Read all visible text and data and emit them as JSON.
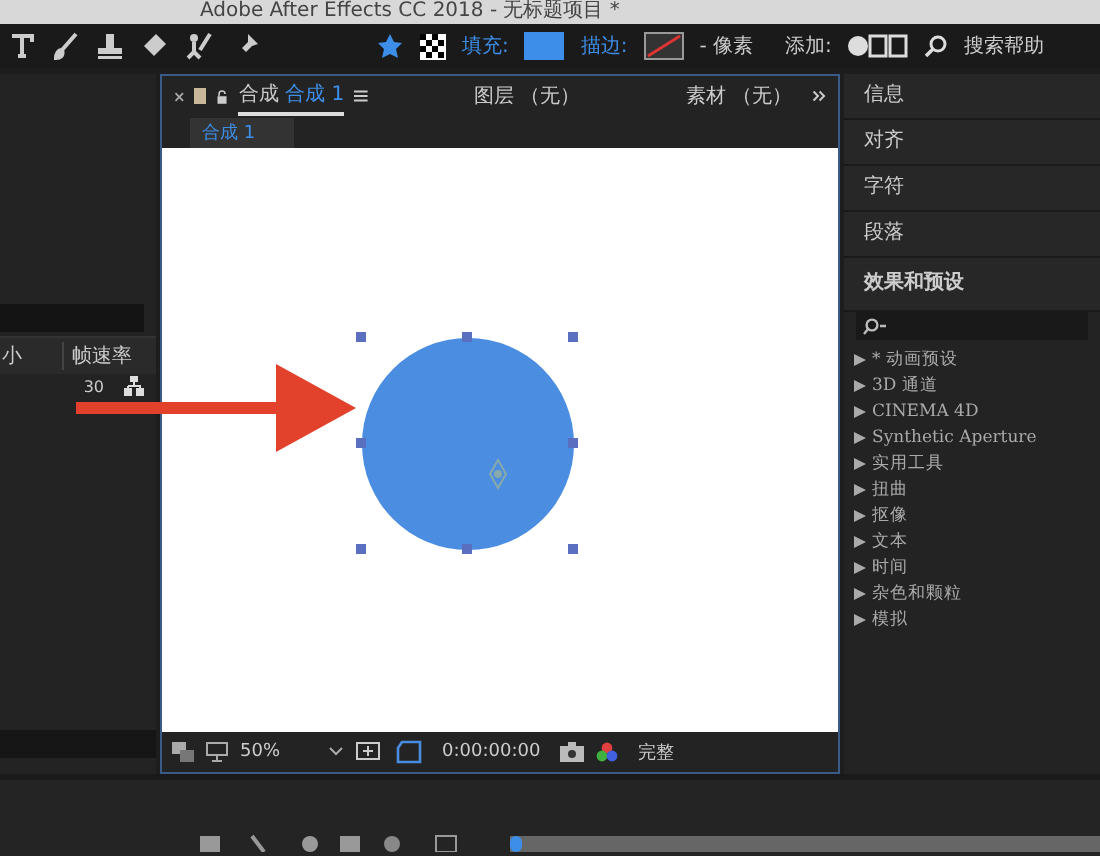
{
  "window": {
    "title": "Adobe After Effects CC 2018 - 无标题项目 *"
  },
  "toolbar": {
    "fill_label": "填充:",
    "stroke_label": "描边:",
    "stroke_unit": "- 像素",
    "add_label": "添加:",
    "search_help": "搜索帮助"
  },
  "project_panel": {
    "columns": [
      "小",
      "帧速率"
    ],
    "rows": [
      {
        "frame_rate": "30"
      }
    ]
  },
  "comp_panel": {
    "tabs": [
      {
        "label": "合成",
        "name": "合成 1",
        "selected": true
      },
      {
        "label": "图层 （无）",
        "selected": false
      },
      {
        "label": "素材 （无）",
        "selected": false
      }
    ],
    "breadcrumb": "合成 1",
    "zoom": "50%",
    "timecode": "0:00:00:00",
    "resolution": "完整"
  },
  "right_panel": {
    "sections": [
      "信息",
      "对齐",
      "字符",
      "段落"
    ],
    "effects_title": "效果和预设",
    "effects": [
      "* 动画预设",
      "3D 通道",
      "CINEMA 4D",
      "Synthetic Aperture",
      "实用工具",
      "扭曲",
      "抠像",
      "文本",
      "时间",
      "杂色和颗粒",
      "模拟"
    ]
  }
}
